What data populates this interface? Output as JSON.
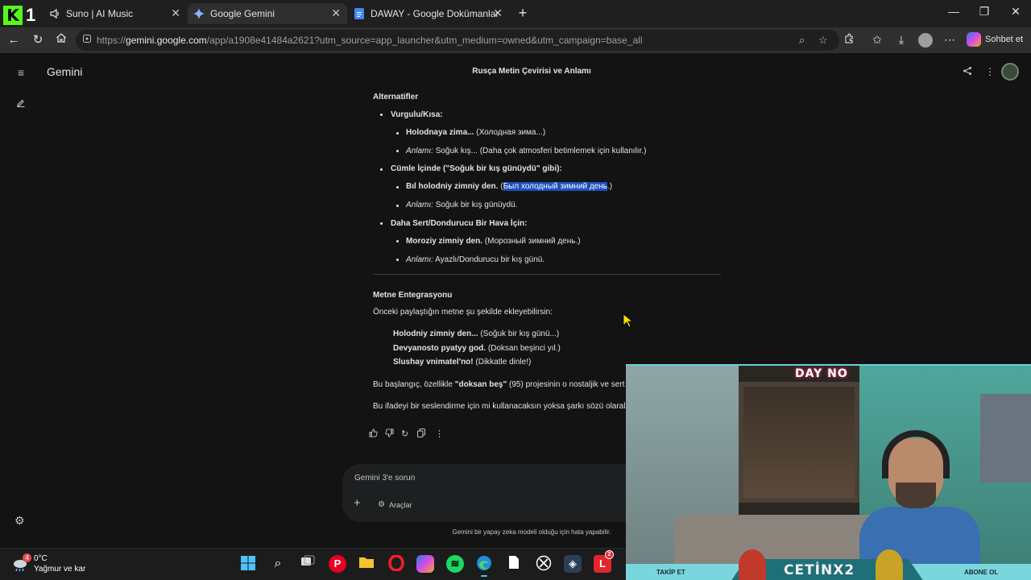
{
  "browser": {
    "tabs": [
      {
        "title": "Suno | AI Music",
        "icon": "speaker-icon"
      },
      {
        "title": "Google Gemini",
        "icon": "gemini-icon"
      },
      {
        "title": "DAWAY - Google Dokümanlar",
        "icon": "docs-icon"
      }
    ],
    "kick_badge": "1",
    "url_prefix": "https://",
    "url_host": "gemini.google.com",
    "url_rest": "/app/a1908e41484a2621?utm_source=app_launcher&utm_medium=owned&utm_campaign=base_all",
    "copilot_label": "Sohbet et"
  },
  "gemini": {
    "brand": "Gemini",
    "chat_title": "Rusça Metin Çevirisi ve Anlamı",
    "section1_title": "Alternatifler",
    "group1_title": "Vurgulu/Kısa:",
    "g1_item1_bold": "Holodnaya zima...",
    "g1_item1_rest": "(Холодная зима...)",
    "g1_item2_italic": "Anlamı:",
    "g1_item2_rest": "Soğuk kış... (Daha çok atmosferi betimlemek için kullanılır.)",
    "group2_title": "Cümle İçinde (\"Soğuk bir kış günüydü\" gibi):",
    "g2_item1_bold": "Bıl holodniy zimniy den.",
    "g2_item1_open": "(",
    "g2_item1_highlight": "Был холодный зимний день",
    "g2_item1_close": ".)",
    "g2_item2_italic": "Anlamı:",
    "g2_item2_rest": "Soğuk bir kış günüydü.",
    "group3_title": "Daha Sert/Dondurucu Bir Hava İçin:",
    "g3_item1_bold": "Moroziy zimniy den.",
    "g3_item1_rest": "(Морозный зимний день.)",
    "g3_item2_italic": "Anlamı:",
    "g3_item2_rest": "Ayazlı/Dondurucu bir kış günü.",
    "section2_title": "Metne Entegrasyonu",
    "section2_intro": "Önceki paylaştığın metne şu şekilde ekleyebilirsin:",
    "quote1_bold": "Holodniy zimniy den...",
    "quote1_rest": "(Soğuk bir kış günü...)",
    "quote2_bold": "Devyanosto pyatyy god.",
    "quote2_rest": "(Doksan beşinci yıl.)",
    "quote3_bold": "Slushay vnimatel'no!",
    "quote3_rest": "(Dikkatle dinle!)",
    "para1_pre": "Bu başlangıç, özellikle ",
    "para1_bold": "\"doksan beş\"",
    "para1_post": " (95) projesinin o nostaljik ve sert",
    "para2": "Bu ifadeyi bir seslendirme için mi kullanacaksın yoksa şarkı sözü olaral",
    "prompt_placeholder": "Gemini 3'e sorun",
    "tools_label": "Araçlar",
    "disclaimer": "Gemini bir yapay zeka modeli olduğu için hata yapabilir."
  },
  "taskbar": {
    "weather_temp": "0°C",
    "weather_desc": "Yağmur ve kar",
    "weather_badge": "4",
    "mail_badge": "2"
  },
  "webcam": {
    "logo": "DAY NO",
    "channel": "CETİNX2",
    "follow": "TAKİP ET",
    "subscribe": "ABONE OL"
  }
}
